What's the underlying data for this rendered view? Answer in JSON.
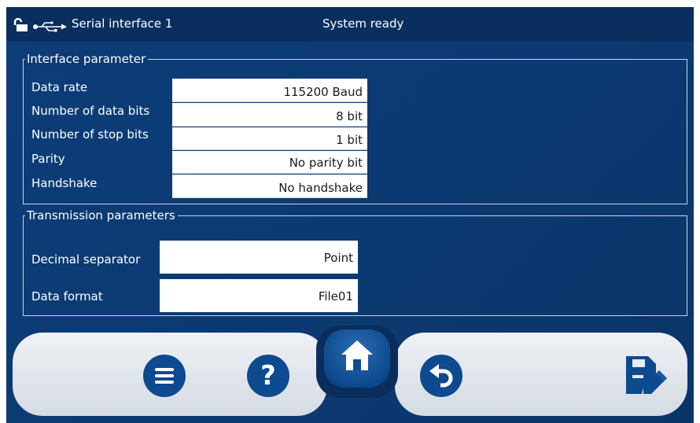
{
  "statusbar": {
    "lock_icon": "unlock-icon",
    "usb_icon": "usb-icon",
    "interface_name": "Serial interface 1",
    "status_text": "System ready"
  },
  "interface_parameter": {
    "title": "Interface parameter",
    "rows": [
      {
        "label": "Data rate",
        "value": "115200 Baud"
      },
      {
        "label": "Number of data bits",
        "value": "8 bit"
      },
      {
        "label": "Number of stop bits",
        "value": "1 bit"
      },
      {
        "label": "Parity",
        "value": "No parity bit"
      },
      {
        "label": "Handshake",
        "value": "No handshake"
      }
    ]
  },
  "transmission_parameters": {
    "title": "Transmission parameters",
    "rows": [
      {
        "label": "Decimal separator",
        "value": "Point"
      },
      {
        "label": "Data format",
        "value": "File01"
      }
    ]
  },
  "toolbar": {
    "icons": [
      "menu-icon",
      "help-icon",
      "home-icon",
      "back-icon",
      "save-edit-icon"
    ]
  },
  "colors": {
    "background": "#0c3b74",
    "statusbar": "#0a2f5e",
    "button_blue": "#0d4a8f",
    "toolbar_light": "#e6eaf0"
  }
}
